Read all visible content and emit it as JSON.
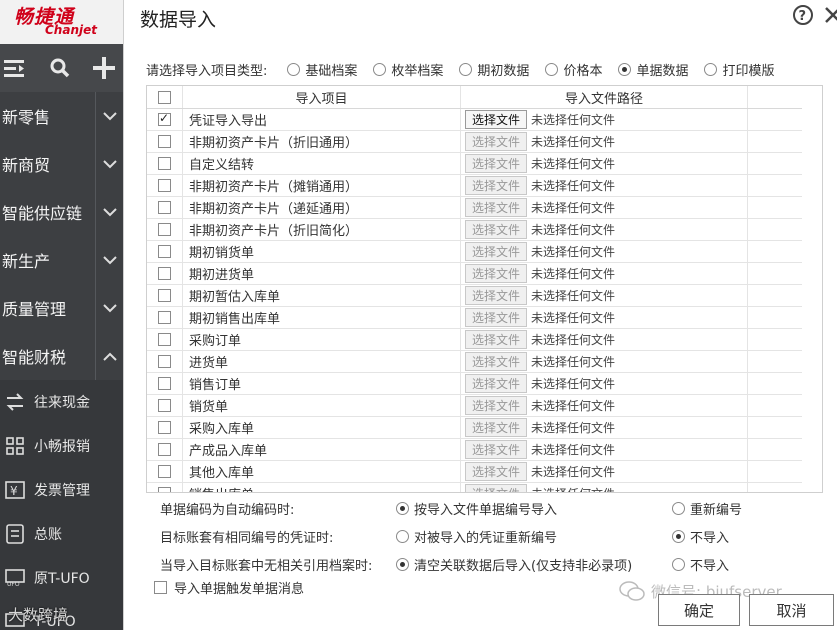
{
  "brand": {
    "logo_cn": "畅捷通",
    "logo_en": "Chanjet"
  },
  "sidebar": {
    "tools": [
      "menu-icon",
      "search-icon",
      "plus-icon"
    ],
    "nav": [
      {
        "label": "新零售",
        "expanded": false
      },
      {
        "label": "新商贸",
        "expanded": false
      },
      {
        "label": "智能供应链",
        "expanded": false
      },
      {
        "label": "新生产",
        "expanded": false
      },
      {
        "label": "质量管理",
        "expanded": false
      },
      {
        "label": "智能财税",
        "expanded": true
      }
    ],
    "subitems": [
      {
        "label": "往来现金",
        "icon": "exchange-icon"
      },
      {
        "label": "小畅报销",
        "icon": "grid-icon"
      },
      {
        "label": "发票管理",
        "icon": "invoice-icon"
      },
      {
        "label": "总账",
        "icon": "ledger-icon"
      },
      {
        "label": "原T-UFO",
        "icon": "ufo-icon"
      },
      {
        "label": "T-UFO",
        "icon": "ufo-icon"
      }
    ]
  },
  "dialog": {
    "title": "数据导入",
    "type_prompt": "请选择导入项目类型:",
    "types": [
      {
        "label": "基础档案",
        "selected": false
      },
      {
        "label": "枚举档案",
        "selected": false
      },
      {
        "label": "期初数据",
        "selected": false
      },
      {
        "label": "价格本",
        "selected": false
      },
      {
        "label": "单据数据",
        "selected": true
      },
      {
        "label": "打印模版",
        "selected": false
      }
    ],
    "grid": {
      "col_item": "导入项目",
      "col_path": "导入文件路径",
      "button_label": "选择文件",
      "status_text": "未选择任何文件",
      "rows": [
        {
          "name": "凭证导入导出",
          "checked": true
        },
        {
          "name": "非期初资产卡片（折旧通用）",
          "checked": false
        },
        {
          "name": "自定义结转",
          "checked": false
        },
        {
          "name": "非期初资产卡片（摊销通用）",
          "checked": false
        },
        {
          "name": "非期初资产卡片（递延通用）",
          "checked": false
        },
        {
          "name": "非期初资产卡片（折旧简化）",
          "checked": false
        },
        {
          "name": "期初销货单",
          "checked": false
        },
        {
          "name": "期初进货单",
          "checked": false
        },
        {
          "name": "期初暂估入库单",
          "checked": false
        },
        {
          "name": "期初销售出库单",
          "checked": false
        },
        {
          "name": "采购订单",
          "checked": false
        },
        {
          "name": "进货单",
          "checked": false
        },
        {
          "name": "销售订单",
          "checked": false
        },
        {
          "name": "销货单",
          "checked": false
        },
        {
          "name": "采购入库单",
          "checked": false
        },
        {
          "name": "产成品入库单",
          "checked": false
        },
        {
          "name": "其他入库单",
          "checked": false
        },
        {
          "name": "销售出库单",
          "checked": false
        }
      ]
    },
    "options": [
      {
        "label": "单据编码为自动编码时:",
        "a": "按导入文件单据编号导入",
        "b": "重新编号",
        "selected": "a"
      },
      {
        "label": "目标账套有相同编号的凭证时:",
        "a": "对被导入的凭证重新编号",
        "b": "不导入",
        "selected": "b"
      },
      {
        "label": "当导入目标账套中无相关引用档案时:",
        "a": "清空关联数据后导入(仅支持非必录项)",
        "b": "不导入",
        "selected": "a"
      }
    ],
    "trigger_label": "导入单据触发单据消息",
    "trigger_checked": false,
    "ok_label": "确定",
    "cancel_label": "取消",
    "watermark": "微信号: bjufserver",
    "overlay_text": "大数跨境"
  }
}
